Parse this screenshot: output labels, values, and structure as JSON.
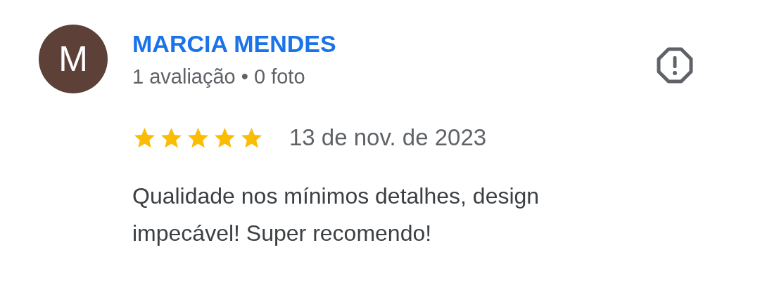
{
  "review": {
    "avatar_letter": "M",
    "author": "MARCIA MENDES",
    "meta": "1 avaliação • 0 foto",
    "stars": 5,
    "date": "13 de nov. de 2023",
    "text": "Qualidade nos mínimos detalhes, design impecável! Super recomendo!"
  }
}
